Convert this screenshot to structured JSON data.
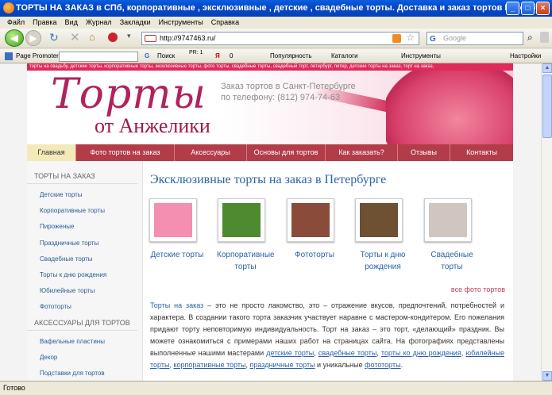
{
  "window": {
    "title": "ТОРТЫ НА ЗАКАЗ в СПб, корпоративные , эксклюзивные , детские , свадебные торты. Доставка и заказ тортов Петербург - Mozilla Firefox",
    "buttons": [
      "_",
      "□",
      "×"
    ]
  },
  "menu": [
    "Файл",
    "Правка",
    "Вид",
    "Журнал",
    "Закладки",
    "Инструменты",
    "Справка"
  ],
  "nav": {
    "url": "http://9747463.ru/",
    "search_placeholder": "Google",
    "search_engine_glyph": "G"
  },
  "toolbar2": {
    "page_promoter": "Page Promoter",
    "search_label": "Поиск",
    "pr_label": "PR: 1",
    "counter": "0",
    "popularity": "Популярность",
    "catalogs": "Каталоги",
    "tools": "Инструменты",
    "settings": "Настройки"
  },
  "site": {
    "tags": "торты на свадьбу, детские торты, корпоративные торты, эксклюзивные торты, фото торты, свадебные торты, свадебный торт, петербург, питер, детские торты на заказ, торт на заказ,",
    "logo_line1": "Торты",
    "logo_line2": "от Анжелики",
    "phone_line1": "Заказ тортов в Санкт-Петербурге",
    "phone_line2": "по телефону: (812) 974-74-63",
    "menu": [
      "Главная",
      "Фото тортов на заказ",
      "Аксессуары",
      "Основы для тортов",
      "Как заказать?",
      "Отзывы",
      "Контакты"
    ],
    "sidebar": {
      "section1": "ТОРТЫ НА ЗАКАЗ",
      "items1": [
        "Детские торты",
        "Корпоративные торты",
        "Пироженые",
        "Праздничные торты",
        "Свадебные торты",
        "Торты к дню рождения",
        "Юбилейные торты",
        "Фототорты"
      ],
      "section2": "АКСЕССУАРЫ ДЛЯ ТОРТОВ",
      "items2": [
        "Вафельные пластины",
        "Декор",
        "Подставки для тортов"
      ]
    },
    "heading": "Эксклюзивные торты на заказ в Петербурге",
    "thumbs": [
      {
        "label": "Детские торты",
        "color": "#f48fb1"
      },
      {
        "label": "Корпоративные торты",
        "color": "#4e8a2f"
      },
      {
        "label": "Фототорты",
        "color": "#8a4b3a"
      },
      {
        "label": "Торты к дню рождения",
        "color": "#6d5132"
      },
      {
        "label": "Свадебные торты",
        "color": "#cfc6c0"
      }
    ],
    "all_photos": "все фото тортов",
    "paragraph": {
      "p1_link": "Торты на заказ",
      "p1_text": " – это не просто лакомство, это – отражение вкусов, предпочтений, потребностей и характера. В создании такого торта заказчик участвует наравне с мастером-кондитером. Его пожелания придают торту неповторимую индивидуальность. Торт на заказ – это торт, «делающий» праздник. Вы можете ознакомиться с примерами наших работ на страницах сайта. На фотографиях представлены выполненные нашими мастерами ",
      "l1": "детские торты",
      "l2": "свадебные торты",
      "l3": "торты ко дню рождения",
      "l4": "юбилейные торты",
      "l5": "корпоративные торты",
      "l6": "праздничные торты",
      "and_unique": " и уникальные ",
      "l7": "фототорты",
      "comma": ", ",
      "dot": "."
    }
  },
  "status": "Готово"
}
